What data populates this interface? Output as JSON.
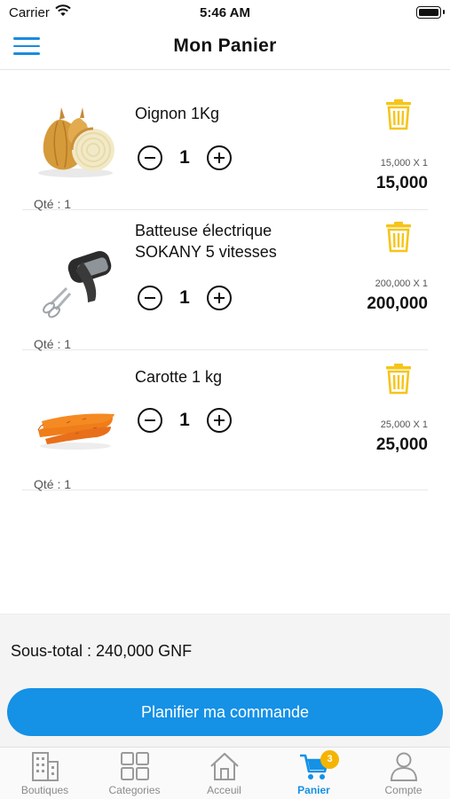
{
  "status": {
    "carrier": "Carrier",
    "time": "5:46 AM"
  },
  "header": {
    "title": "Mon Panier"
  },
  "items": [
    {
      "name": "Oignon 1Kg",
      "qty": "1",
      "unit_price": "15,000 X 1",
      "total": "15,000",
      "qte_label": "Qté : 1",
      "image": "onion-image"
    },
    {
      "name": "Batteuse électrique SOKANY 5 vitesses",
      "qty": "1",
      "unit_price": "200,000 X 1",
      "total": "200,000",
      "qte_label": "Qté : 1",
      "image": "mixer-image"
    },
    {
      "name": "Carotte 1 kg",
      "qty": "1",
      "unit_price": "25,000 X 1",
      "total": "25,000",
      "qte_label": "Qté : 1",
      "image": "carrot-image"
    }
  ],
  "summary": {
    "subtotal": "Sous-total : 240,000 GNF",
    "cta": "Planifier ma commande"
  },
  "tabs": [
    {
      "label": "Boutiques",
      "icon": "building-icon"
    },
    {
      "label": "Categories",
      "icon": "grid-icon"
    },
    {
      "label": "Acceuil",
      "icon": "home-icon"
    },
    {
      "label": "Panier",
      "icon": "cart-icon",
      "badge": "3",
      "active": true
    },
    {
      "label": "Compte",
      "icon": "user-icon"
    }
  ],
  "colors": {
    "accent": "#1591e6",
    "trash": "#f5c518",
    "badge": "#f5b400"
  }
}
